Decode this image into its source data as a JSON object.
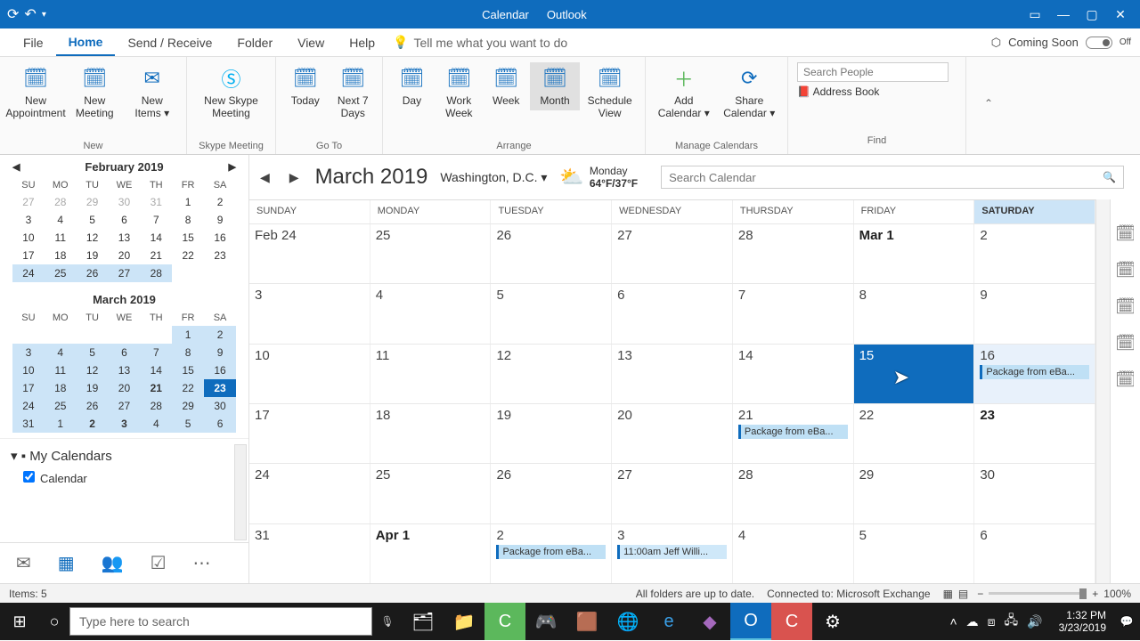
{
  "titlebar": {
    "title_left": "Calendar",
    "title_right": "Outlook"
  },
  "menu": {
    "tabs": [
      "File",
      "Home",
      "Send / Receive",
      "Folder",
      "View",
      "Help"
    ],
    "active": 1,
    "tellme": "Tell me what you want to do",
    "coming": "Coming Soon",
    "toggle": "Off"
  },
  "ribbon": {
    "new": {
      "appointment": "New\nAppointment",
      "meeting": "New\nMeeting",
      "items": "New\nItems ▾",
      "label": "New"
    },
    "skype": {
      "btn": "New Skype\nMeeting",
      "label": "Skype Meeting"
    },
    "goto": {
      "today": "Today",
      "next7": "Next 7\nDays",
      "label": "Go To"
    },
    "arrange": {
      "day": "Day",
      "workweek": "Work\nWeek",
      "week": "Week",
      "month": "Month",
      "schedule": "Schedule\nView",
      "label": "Arrange"
    },
    "manage": {
      "add": "Add\nCalendar ▾",
      "share": "Share\nCalendar ▾",
      "label": "Manage Calendars"
    },
    "find": {
      "placeholder": "Search People",
      "addr": "Address Book",
      "label": "Find"
    }
  },
  "miniFeb": {
    "title": "February 2019",
    "dow": [
      "SU",
      "MO",
      "TU",
      "WE",
      "TH",
      "FR",
      "SA"
    ],
    "rows": [
      [
        "27",
        "28",
        "29",
        "30",
        "31",
        "1",
        "2"
      ],
      [
        "3",
        "4",
        "5",
        "6",
        "7",
        "8",
        "9"
      ],
      [
        "10",
        "11",
        "12",
        "13",
        "14",
        "15",
        "16"
      ],
      [
        "17",
        "18",
        "19",
        "20",
        "21",
        "22",
        "23"
      ],
      [
        "24",
        "25",
        "26",
        "27",
        "28",
        "",
        ""
      ]
    ]
  },
  "miniMar": {
    "title": "March 2019",
    "dow": [
      "SU",
      "MO",
      "TU",
      "WE",
      "TH",
      "FR",
      "SA"
    ],
    "rows": [
      [
        "",
        "",
        "",
        "",
        "",
        "1",
        "2"
      ],
      [
        "3",
        "4",
        "5",
        "6",
        "7",
        "8",
        "9"
      ],
      [
        "10",
        "11",
        "12",
        "13",
        "14",
        "15",
        "16"
      ],
      [
        "17",
        "18",
        "19",
        "20",
        "21",
        "22",
        "23"
      ],
      [
        "24",
        "25",
        "26",
        "27",
        "28",
        "29",
        "30"
      ],
      [
        "31",
        "1",
        "2",
        "3",
        "4",
        "5",
        "6"
      ]
    ]
  },
  "mycals": {
    "title": "My Calendars",
    "item": "Calendar"
  },
  "calhdr": {
    "month": "March 2019",
    "loc": "Washington,  D.C. ▾",
    "day": "Monday",
    "temp": "64°F/37°F",
    "searchPlaceholder": "Search Calendar"
  },
  "dow": [
    "SUNDAY",
    "MONDAY",
    "TUESDAY",
    "WEDNESDAY",
    "THURSDAY",
    "FRIDAY",
    "SATURDAY"
  ],
  "weeks": [
    [
      "Feb 24",
      "25",
      "26",
      "27",
      "28",
      "Mar 1",
      "2"
    ],
    [
      "3",
      "4",
      "5",
      "6",
      "7",
      "8",
      "9"
    ],
    [
      "10",
      "11",
      "12",
      "13",
      "14",
      "15",
      "16"
    ],
    [
      "17",
      "18",
      "19",
      "20",
      "21",
      "22",
      "23"
    ],
    [
      "24",
      "25",
      "26",
      "27",
      "28",
      "29",
      "30"
    ],
    [
      "31",
      "Apr 1",
      "2",
      "3",
      "4",
      "5",
      "6"
    ]
  ],
  "events": {
    "pkg": "Package from eBa...",
    "jeff": "11:00am Jeff Willi..."
  },
  "status": {
    "items": "Items: 5",
    "sync": "All folders are up to date.",
    "conn": "Connected to: Microsoft Exchange",
    "zoom": "100%"
  },
  "taskbar": {
    "searchPlaceholder": "Type here to search",
    "time": "1:32 PM",
    "date": "3/23/2019"
  }
}
